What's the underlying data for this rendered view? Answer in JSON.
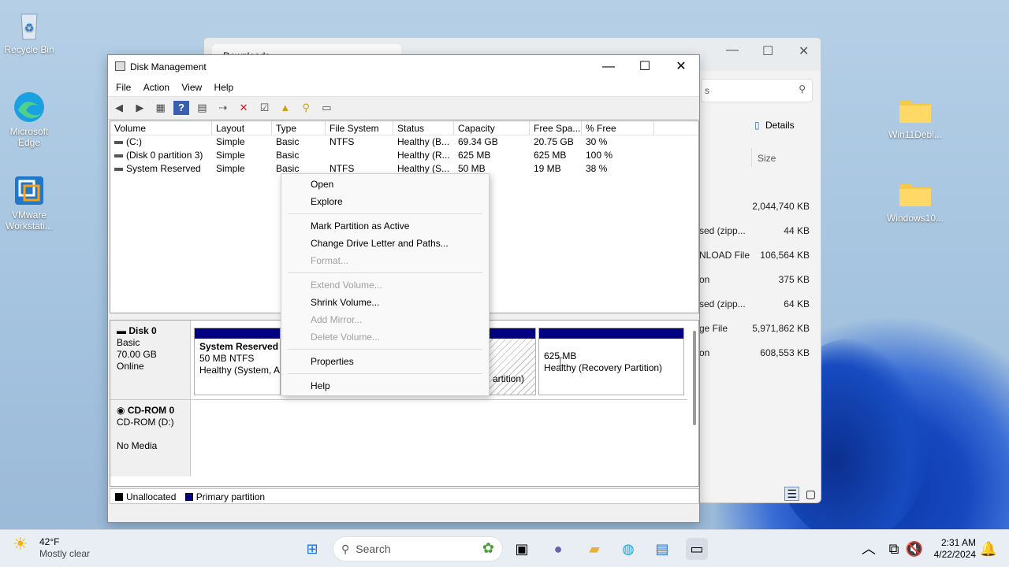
{
  "desktop": {
    "icons": [
      {
        "label": "Recycle Bin"
      },
      {
        "label": "Microsoft Edge"
      },
      {
        "label": "VMware Workstati..."
      },
      {
        "label": "Win11Debl..."
      },
      {
        "label": "Windows10..."
      }
    ]
  },
  "explorer": {
    "tab_title": "Downloads",
    "addr_tail": "s",
    "details_label": "Details",
    "size_header": "Size",
    "rows": [
      {
        "type": "",
        "size": "2,044,740 KB"
      },
      {
        "type": "sed (zipp...",
        "size": "44 KB"
      },
      {
        "type": "NLOAD File",
        "size": "106,564 KB"
      },
      {
        "type": "on",
        "size": "375 KB"
      },
      {
        "type": "sed (zipp...",
        "size": "64 KB"
      },
      {
        "type": "ge File",
        "size": "5,971,862 KB"
      },
      {
        "type": "on",
        "size": "608,553 KB"
      }
    ]
  },
  "disk_management": {
    "title": "Disk Management",
    "menu": [
      "File",
      "Action",
      "View",
      "Help"
    ],
    "columns": [
      "Volume",
      "Layout",
      "Type",
      "File System",
      "Status",
      "Capacity",
      "Free Spa...",
      "% Free"
    ],
    "volumes": [
      {
        "volume": "(C:)",
        "layout": "Simple",
        "type": "Basic",
        "fs": "NTFS",
        "status": "Healthy (B...",
        "capacity": "69.34 GB",
        "free": "20.75 GB",
        "pct": "30 %"
      },
      {
        "volume": "(Disk 0 partition 3)",
        "layout": "Simple",
        "type": "Basic",
        "fs": "",
        "status": "Healthy (R...",
        "capacity": "625 MB",
        "free": "625 MB",
        "pct": "100 %"
      },
      {
        "volume": "System Reserved",
        "layout": "Simple",
        "type": "Basic",
        "fs": "NTFS",
        "status": "Healthy (S...",
        "capacity": "50 MB",
        "free": "19 MB",
        "pct": "38 %"
      }
    ],
    "disk0": {
      "name": "Disk 0",
      "kind": "Basic",
      "size": "70.00 GB",
      "state": "Online",
      "partitions": [
        {
          "name": "System Reserved",
          "size": "50 MB NTFS",
          "status": "Healthy (System, A"
        },
        {
          "name": "",
          "size": "",
          "status": "artition)"
        },
        {
          "name": "",
          "size": "625 MB",
          "status": "Healthy (Recovery Partition)"
        }
      ]
    },
    "cdrom": {
      "name": "CD-ROM 0",
      "kind": "CD-ROM (D:)",
      "state": "No Media"
    },
    "legend": {
      "unallocated": "Unallocated",
      "primary": "Primary partition"
    }
  },
  "context_menu": {
    "open": "Open",
    "explore": "Explore",
    "mark_active": "Mark Partition as Active",
    "change_letter": "Change Drive Letter and Paths...",
    "format": "Format...",
    "extend": "Extend Volume...",
    "shrink": "Shrink Volume...",
    "add_mirror": "Add Mirror...",
    "delete": "Delete Volume...",
    "properties": "Properties",
    "help": "Help"
  },
  "taskbar": {
    "temp": "42°F",
    "weather": "Mostly clear",
    "search_placeholder": "Search",
    "time": "2:31 AM",
    "date": "4/22/2024"
  },
  "colors": {
    "primary_partition": "#000080",
    "unallocated": "#000000"
  }
}
